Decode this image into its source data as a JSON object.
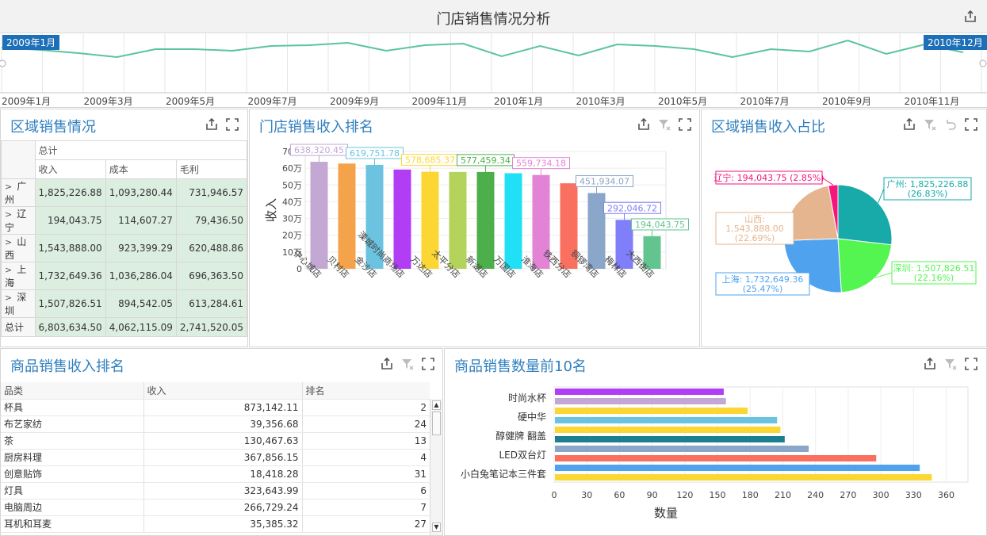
{
  "page": {
    "title": "门店销售情况分析"
  },
  "timeline": {
    "start_label": "2009年1月",
    "end_label": "2010年12月",
    "ticks": [
      "2009年1月",
      "2009年3月",
      "2009年5月",
      "2009年7月",
      "2009年9月",
      "2009年11月",
      "2010年1月",
      "2010年3月",
      "2010年5月",
      "2010年7月",
      "2010年9月",
      "2010年11月"
    ],
    "line_color": "#5bc49f"
  },
  "region_table": {
    "title": "区域销售情况",
    "group_header": "总计",
    "columns": [
      "收入",
      "成本",
      "毛利"
    ],
    "rows": [
      {
        "name": "广州",
        "v": [
          "1,825,226.88",
          "1,093,280.44",
          "731,946.57"
        ]
      },
      {
        "name": "辽宁",
        "v": [
          "194,043.75",
          "114,607.27",
          "79,436.50"
        ]
      },
      {
        "name": "山西",
        "v": [
          "1,543,888.00",
          "923,399.29",
          "620,488.86"
        ]
      },
      {
        "name": "上海",
        "v": [
          "1,732,649.36",
          "1,036,286.04",
          "696,363.50"
        ]
      },
      {
        "name": "深圳",
        "v": [
          "1,507,826.51",
          "894,542.05",
          "613,284.61"
        ]
      }
    ],
    "total": {
      "name": "总计",
      "v": [
        "6,803,634.50",
        "4,062,115.09",
        "2,741,520.05"
      ]
    }
  },
  "store_rank": {
    "title": "门店销售收入排名",
    "chart_data": {
      "type": "bar",
      "ylabel": "收入",
      "yticks": [
        "0",
        "10万",
        "20万",
        "30万",
        "40万",
        "50万",
        "60万",
        "70万"
      ],
      "ylim": [
        0,
        700000
      ],
      "categories": [
        "中心城店",
        "贝村店",
        "金沙店",
        "溧城时尚商场店",
        "万达店",
        "太平分店",
        "新湖店",
        "万国店",
        "淮海店",
        "铁西分店",
        "铜锣湾店",
        "梅林店",
        "大西街店"
      ],
      "values": [
        638320.45,
        628000,
        619751.78,
        592000,
        578685.37,
        577500,
        577459.34,
        570000,
        559734.18,
        510000,
        451934.07,
        292046.72,
        194043.75
      ],
      "labels": [
        "638,320.45",
        "",
        "619,751.78",
        "",
        "578,685.37",
        "",
        "577,459.34",
        "",
        "559,734.18",
        "",
        "451,934.07",
        "292,046.72",
        "194,043.75"
      ],
      "colors": [
        "#c3a8d3",
        "#f5a34a",
        "#6bc3e0",
        "#b13ef5",
        "#fcd733",
        "#b3d35a",
        "#4dae4c",
        "#1fe0f5",
        "#e383d6",
        "#fa7060",
        "#8aa6c8",
        "#7f7ffa",
        "#62c590"
      ]
    }
  },
  "region_share": {
    "title": "区域销售收入占比",
    "chart_data": {
      "type": "pie",
      "slices": [
        {
          "name": "广州",
          "value": 1825226.88,
          "label": "广州: 1,825,226.88",
          "pct": "(26.83%)",
          "color": "#17aaa8"
        },
        {
          "name": "深圳",
          "value": 1507826.51,
          "label": "深圳: 1,507,826.51",
          "pct": "(22.16%)",
          "color": "#54f550"
        },
        {
          "name": "上海",
          "value": 1732649.36,
          "label": "上海: 1,732,649.36",
          "pct": "(25.47%)",
          "color": "#4fa3ee"
        },
        {
          "name": "山西",
          "value": 1543888.0,
          "label": "山西:",
          "label2": "1,543,888.00",
          "pct": "(22.69%)",
          "color": "#e5b58f"
        },
        {
          "name": "辽宁",
          "value": 194043.75,
          "label": "辽宁: 194,043.75 (2.85%)",
          "pct": "",
          "color": "#f5157c"
        }
      ]
    }
  },
  "product_rank": {
    "title": "商品销售收入排名",
    "columns": [
      "品类",
      "收入",
      "排名"
    ],
    "rows": [
      [
        "杯具",
        "873,142.11",
        "2"
      ],
      [
        "布艺家纺",
        "39,356.68",
        "24"
      ],
      [
        "茶",
        "130,467.63",
        "13"
      ],
      [
        "厨房料理",
        "367,856.15",
        "4"
      ],
      [
        "创意贴饰",
        "18,418.28",
        "31"
      ],
      [
        "灯具",
        "323,643.99",
        "6"
      ],
      [
        "电脑周边",
        "266,729.24",
        "7"
      ],
      [
        "耳机和耳麦",
        "35,385.32",
        "27"
      ]
    ]
  },
  "top10": {
    "title": "商品销售数量前10名",
    "chart_data": {
      "type": "bar",
      "orientation": "horizontal",
      "xlabel": "数量",
      "xlim": [
        0,
        380
      ],
      "xticks": [
        "0",
        "30",
        "60",
        "90",
        "120",
        "150",
        "180",
        "210",
        "240",
        "270",
        "300",
        "330",
        "360"
      ],
      "category_labels": [
        "时尚水杯",
        "",
        "硬中华",
        "",
        "醇健牌 翻盖",
        "",
        "LED双台灯",
        "",
        "小白兔笔记本三件套",
        ""
      ],
      "values": [
        155,
        157,
        177,
        204,
        207,
        211,
        233,
        295,
        335,
        346
      ],
      "colors": [
        "#b13ef5",
        "#c3a8d3",
        "#fcd733",
        "#6bc3e0",
        "#fcd733",
        "#1b7f8f",
        "#8aa6c8",
        "#fa7060",
        "#4fa3ee",
        "#fcd733"
      ]
    }
  },
  "icons": {
    "export": "export-icon",
    "fullscreen": "fullscreen-icon",
    "filter": "filter-clear-icon",
    "undo": "undo-icon"
  }
}
